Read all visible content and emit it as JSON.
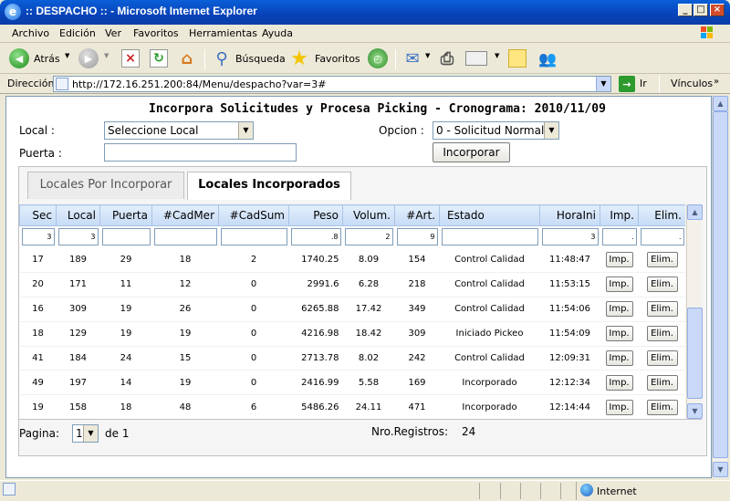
{
  "window": {
    "title": ":: DESPACHO :: - Microsoft Internet Explorer"
  },
  "menu": [
    "Archivo",
    "Edición",
    "Ver",
    "Favoritos",
    "Herramientas",
    "Ayuda"
  ],
  "toolbar": {
    "back_label": "Atrás",
    "search_label": "Búsqueda",
    "favorites_label": "Favoritos"
  },
  "address": {
    "label": "Dirección",
    "url": "http://172.16.251.200:84/Menu/despacho?var=3#",
    "go_label": "Ir",
    "links_label": "Vínculos"
  },
  "page": {
    "title": "Incorpora Solicitudes y Procesa Picking - Cronograma: 2010/11/09",
    "local_label": "Local :",
    "local_value": "Seleccione Local",
    "puerta_label": "Puerta :",
    "opcion_label": "Opcion :",
    "opcion_value": "0 - Solicitud Normal",
    "incorporar_label": "Incorporar"
  },
  "tabs": [
    {
      "label": "Locales Por Incorporar",
      "active": false
    },
    {
      "label": "Locales Incorporados",
      "active": true
    }
  ],
  "grid": {
    "columns": [
      "Sec",
      "Local",
      "Puerta",
      "#CadMer",
      "#CadSum",
      "Peso",
      "Volum.",
      "#Art.",
      "Estado",
      "HoraIni",
      "Imp.",
      "Elim."
    ],
    "filters": [
      "3",
      "3",
      "",
      "",
      "",
      ".8",
      "2",
      "9",
      "",
      "3",
      ".",
      "."
    ],
    "rows": [
      [
        "17",
        "189",
        "29",
        "18",
        "2",
        "1740.25",
        "8.09",
        "154",
        "Control Calidad",
        "11:48:47"
      ],
      [
        "20",
        "171",
        "11",
        "12",
        "0",
        "2991.6",
        "6.28",
        "218",
        "Control Calidad",
        "11:53:15"
      ],
      [
        "16",
        "309",
        "19",
        "26",
        "0",
        "6265.88",
        "17.42",
        "349",
        "Control Calidad",
        "11:54:06"
      ],
      [
        "18",
        "129",
        "19",
        "19",
        "0",
        "4216.98",
        "18.42",
        "309",
        "Iniciado Pickeo",
        "11:54:09"
      ],
      [
        "41",
        "184",
        "24",
        "15",
        "0",
        "2713.78",
        "8.02",
        "242",
        "Control Calidad",
        "12:09:31"
      ],
      [
        "49",
        "197",
        "14",
        "19",
        "0",
        "2416.99",
        "5.58",
        "169",
        "Incorporado",
        "12:12:34"
      ],
      [
        "19",
        "158",
        "18",
        "48",
        "6",
        "5486.26",
        "24.11",
        "471",
        "Incorporado",
        "12:14:44"
      ]
    ],
    "imp_label": "Imp.",
    "elim_label": "Elim."
  },
  "pager": {
    "label": "Pagina:",
    "page": "1",
    "of_label": "de 1",
    "records_label": "Nro.Registros:",
    "records": "24"
  },
  "status": {
    "zone": "Internet"
  },
  "colors": {
    "titlebar": "#0842b8",
    "header_grad": "#c6dbf6"
  }
}
